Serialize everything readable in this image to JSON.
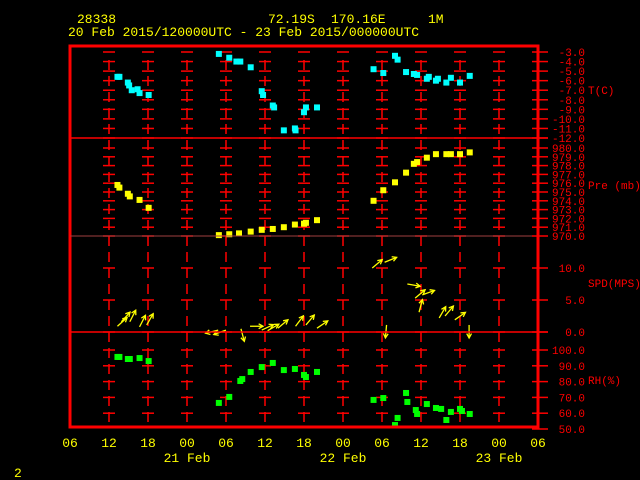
{
  "header": {
    "station": "28338",
    "lat": "72.19S",
    "lon": "170.16E",
    "height": "1M",
    "period": "20 Feb 2015/120000UTC - 23 Feb 2015/000000UTC"
  },
  "footer": {
    "page": "2"
  },
  "colors": {
    "frame": "#ff0000",
    "text": "#ffff00",
    "temp": "#00ffff",
    "pres": "#ffff00",
    "wind": "#ffff00",
    "rh": "#00ff00"
  },
  "chart_data": {
    "type": "scatter",
    "x_unit": "hours since 20 Feb 2015 00UTC",
    "xlim": [
      6,
      78
    ],
    "x_ticks": [
      {
        "t": 6,
        "label": "06"
      },
      {
        "t": 12,
        "label": "12"
      },
      {
        "t": 18,
        "label": "18"
      },
      {
        "t": 24,
        "label": "00"
      },
      {
        "t": 30,
        "label": "06"
      },
      {
        "t": 36,
        "label": "12"
      },
      {
        "t": 42,
        "label": "18"
      },
      {
        "t": 48,
        "label": "00"
      },
      {
        "t": 54,
        "label": "06"
      },
      {
        "t": 60,
        "label": "12"
      },
      {
        "t": 66,
        "label": "18"
      },
      {
        "t": 72,
        "label": "00"
      },
      {
        "t": 78,
        "label": "06"
      }
    ],
    "date_labels": [
      {
        "t": 24,
        "label": "21 Feb"
      },
      {
        "t": 48,
        "label": "22 Feb"
      },
      {
        "t": 72,
        "label": "23 Feb"
      }
    ],
    "panels": {
      "temp": {
        "label": "T(C)",
        "ylim": [
          -12,
          -3
        ],
        "ticks": [
          "-3.0",
          "-4.0",
          "-5.0",
          "-6.0",
          "-7.0",
          "-8.0",
          "-9.0",
          "-10.0",
          "-11.0",
          "-12.0"
        ],
        "points": [
          [
            13.3,
            -5.6
          ],
          [
            13.6,
            -5.6
          ],
          [
            14.9,
            -6.2
          ],
          [
            15.1,
            -6.5
          ],
          [
            15.5,
            -7.0
          ],
          [
            16.4,
            -6.9
          ],
          [
            16.7,
            -7.3
          ],
          [
            18.1,
            -7.5
          ],
          [
            28.9,
            -3.2
          ],
          [
            30.5,
            -3.6
          ],
          [
            31.6,
            -4.0
          ],
          [
            32.2,
            -4.0
          ],
          [
            33.8,
            -4.6
          ],
          [
            35.5,
            -7.1
          ],
          [
            35.7,
            -7.5
          ],
          [
            37.2,
            -8.6
          ],
          [
            37.4,
            -8.8
          ],
          [
            38.9,
            -11.2
          ],
          [
            40.6,
            -11.0
          ],
          [
            40.7,
            -11.2
          ],
          [
            42.0,
            -9.3
          ],
          [
            42.3,
            -8.8
          ],
          [
            44.0,
            -8.8
          ],
          [
            52.7,
            -4.8
          ],
          [
            54.2,
            -5.2
          ],
          [
            56.0,
            -3.4
          ],
          [
            56.4,
            -3.8
          ],
          [
            57.7,
            -5.1
          ],
          [
            58.9,
            -5.3
          ],
          [
            59.4,
            -5.4
          ],
          [
            60.9,
            -5.8
          ],
          [
            61.2,
            -5.6
          ],
          [
            62.3,
            -6.0
          ],
          [
            62.6,
            -5.8
          ],
          [
            63.9,
            -6.2
          ],
          [
            64.6,
            -5.7
          ],
          [
            66.0,
            -6.2
          ],
          [
            67.5,
            -5.5
          ]
        ]
      },
      "pres": {
        "label": "Pre (mb)",
        "ylim": [
          970,
          980
        ],
        "ticks": [
          "980.0",
          "979.0",
          "978.0",
          "977.0",
          "976.0",
          "975.0",
          "974.0",
          "973.0",
          "972.0",
          "971.0",
          "970.0"
        ],
        "points": [
          [
            13.3,
            975.8
          ],
          [
            13.6,
            975.5
          ],
          [
            14.9,
            974.8
          ],
          [
            15.2,
            974.5
          ],
          [
            16.7,
            974.1
          ],
          [
            18.1,
            973.2
          ],
          [
            28.9,
            970.1
          ],
          [
            30.5,
            970.2
          ],
          [
            32.0,
            970.3
          ],
          [
            33.8,
            970.5
          ],
          [
            35.5,
            970.7
          ],
          [
            37.2,
            970.8
          ],
          [
            38.9,
            971.0
          ],
          [
            40.6,
            971.3
          ],
          [
            42.0,
            971.4
          ],
          [
            42.3,
            971.5
          ],
          [
            44.0,
            971.8
          ],
          [
            52.7,
            974.0
          ],
          [
            54.2,
            975.2
          ],
          [
            56.0,
            976.1
          ],
          [
            57.7,
            977.2
          ],
          [
            58.9,
            978.2
          ],
          [
            59.4,
            978.4
          ],
          [
            60.9,
            978.9
          ],
          [
            62.3,
            979.3
          ],
          [
            63.9,
            979.3
          ],
          [
            64.6,
            979.3
          ],
          [
            66.0,
            979.3
          ],
          [
            67.5,
            979.5
          ]
        ]
      },
      "wind": {
        "label": "SPD(MPS)",
        "ylim": [
          0,
          15
        ],
        "ticks": [
          "10.0",
          "5.0",
          "0.0"
        ],
        "fields": [
          "t",
          "speed_mps",
          "direction_toward_deg"
        ],
        "points": [
          [
            13.3,
            0.9,
            48
          ],
          [
            13.9,
            1.6,
            42
          ],
          [
            15.2,
            1.6,
            27
          ],
          [
            16.7,
            0.8,
            27
          ],
          [
            17.8,
            1.1,
            30
          ],
          [
            28.8,
            0.3,
            256
          ],
          [
            30.0,
            0.3,
            250
          ],
          [
            32.3,
            0.5,
            165
          ],
          [
            33.7,
            0.9,
            90
          ],
          [
            35.5,
            0.3,
            65
          ],
          [
            36.4,
            0.2,
            60
          ],
          [
            38.0,
            0.6,
            50
          ],
          [
            40.7,
            0.9,
            37
          ],
          [
            42.3,
            1.1,
            40
          ],
          [
            44.0,
            0.6,
            56
          ],
          [
            52.5,
            10.0,
            50
          ],
          [
            54.4,
            10.9,
            68
          ],
          [
            57.9,
            7.5,
            100
          ],
          [
            59.1,
            5.3,
            50
          ],
          [
            60.2,
            5.8,
            70
          ],
          [
            54.7,
            1.1,
            185
          ],
          [
            59.7,
            3.1,
            15
          ],
          [
            62.8,
            2.2,
            30
          ],
          [
            63.7,
            2.5,
            40
          ],
          [
            65.2,
            1.9,
            55
          ],
          [
            67.4,
            1.1,
            180
          ]
        ]
      },
      "rh": {
        "label": "RH(%)",
        "ylim": [
          50,
          100
        ],
        "ticks": [
          "100.0",
          "90.0",
          "80.0",
          "70.0",
          "60.0",
          "50.0"
        ],
        "points": [
          [
            13.3,
            95.6
          ],
          [
            13.6,
            95.6
          ],
          [
            14.9,
            94.3
          ],
          [
            15.2,
            94.3
          ],
          [
            16.7,
            94.9
          ],
          [
            18.1,
            93.0
          ],
          [
            28.9,
            66.5
          ],
          [
            30.5,
            70.3
          ],
          [
            32.2,
            80.4
          ],
          [
            32.5,
            81.6
          ],
          [
            33.8,
            86.1
          ],
          [
            35.5,
            89.2
          ],
          [
            37.2,
            91.8
          ],
          [
            38.9,
            87.3
          ],
          [
            40.6,
            88.0
          ],
          [
            42.0,
            84.2
          ],
          [
            42.3,
            82.9
          ],
          [
            44.0,
            86.1
          ],
          [
            52.7,
            68.4
          ],
          [
            54.2,
            69.6
          ],
          [
            56.0,
            52.5
          ],
          [
            56.4,
            57.0
          ],
          [
            57.7,
            72.8
          ],
          [
            57.9,
            67.1
          ],
          [
            59.2,
            62.0
          ],
          [
            59.4,
            59.5
          ],
          [
            60.9,
            65.8
          ],
          [
            62.3,
            63.3
          ],
          [
            63.1,
            62.7
          ],
          [
            63.9,
            55.7
          ],
          [
            64.6,
            60.8
          ],
          [
            66.0,
            62.7
          ],
          [
            66.3,
            61.4
          ],
          [
            67.5,
            59.5
          ]
        ]
      }
    }
  }
}
